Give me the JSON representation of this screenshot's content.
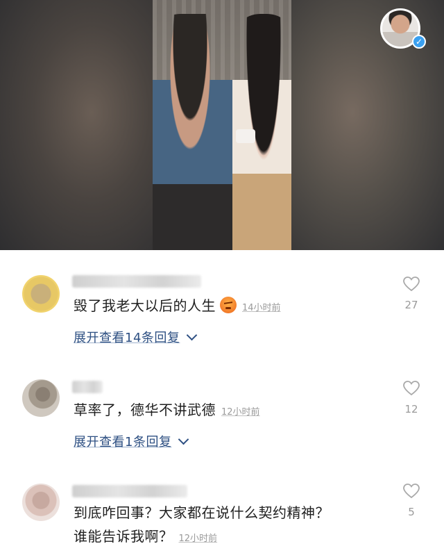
{
  "comments": [
    {
      "text": "毁了我老大以后的人生",
      "time": "14小时前",
      "reply_label": "展开查看14条回复",
      "likes": "27"
    },
    {
      "text": "草率了，德华不讲武德",
      "time": "12小时前",
      "reply_label": "展开查看1条回复",
      "likes": "12"
    },
    {
      "text_line1": "到底咋回事？大家都在说什么契约精神？",
      "text_line2": "谁能告诉我啊？",
      "time": "12小时前",
      "likes": "5"
    }
  ],
  "icons": {
    "heart": "heart-icon",
    "chevron": "chevron-down-icon",
    "verified": "verified-check-icon",
    "angry_emoji": "angry-face-emoji-icon"
  },
  "colors": {
    "reply_link": "#2d4f82",
    "meta_gray": "#9a9a9a",
    "verify_blue": "#3aa0f0"
  }
}
